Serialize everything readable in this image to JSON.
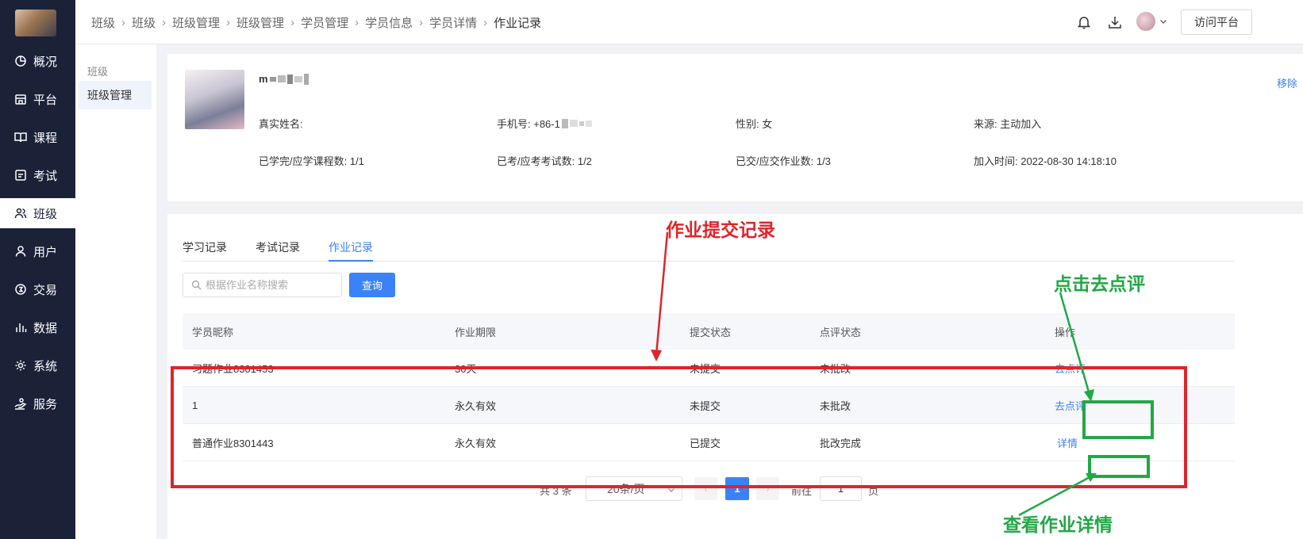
{
  "sidebar": {
    "logo_alt": "",
    "items": [
      {
        "label": "概况",
        "icon": "pie-chart-icon"
      },
      {
        "label": "平台",
        "icon": "storefront-icon"
      },
      {
        "label": "课程",
        "icon": "open-book-icon"
      },
      {
        "label": "考试",
        "icon": "exam-icon"
      },
      {
        "label": "班级",
        "icon": "users-icon",
        "active": true
      },
      {
        "label": "用户",
        "icon": "user-icon"
      },
      {
        "label": "交易",
        "icon": "transaction-icon"
      },
      {
        "label": "数据",
        "icon": "bar-chart-icon"
      },
      {
        "label": "系统",
        "icon": "gear-icon"
      },
      {
        "label": "服务",
        "icon": "service-icon"
      }
    ]
  },
  "header": {
    "breadcrumb": [
      "班级",
      "班级",
      "班级管理",
      "班级管理",
      "学员管理",
      "学员信息",
      "学员详情",
      "作业记录"
    ],
    "visit_label": "访问平台"
  },
  "subnav": {
    "group_label": "班级",
    "item_label": "班级管理"
  },
  "student": {
    "name_visible": "m",
    "remove_label": "移除",
    "fields": {
      "real_name": "真实姓名:",
      "phone": "手机号: +86-1",
      "gender": "性别: 女",
      "source": "来源: 主动加入",
      "courses": "已学完/应学课程数: 1/1",
      "exams": "已考/应考考试数: 1/2",
      "homework": "已交/应交作业数: 1/3",
      "join_time": "加入时间: 2022-08-30 14:18:10"
    }
  },
  "records": {
    "tabs": [
      "学习记录",
      "考试记录",
      "作业记录"
    ],
    "active_tab": 2,
    "search_placeholder": "根据作业名称搜索",
    "query_label": "查询",
    "columns": [
      "学员昵称",
      "作业期限",
      "提交状态",
      "点评状态",
      "操作"
    ],
    "rows": [
      {
        "name": "习题作业8301453",
        "deadline": "30天",
        "submit": "未提交",
        "review": "未批改",
        "action": "去点评"
      },
      {
        "name": "1",
        "deadline": "永久有效",
        "submit": "未提交",
        "review": "未批改",
        "action": "去点评"
      },
      {
        "name": "普通作业8301443",
        "deadline": "永久有效",
        "submit": "已提交",
        "review": "批改完成",
        "action": "详情"
      }
    ]
  },
  "pagination": {
    "total": "共 3 条",
    "page_size": "20条/页",
    "prev": "‹",
    "current": "1",
    "next": "›",
    "goto_label": "前往",
    "goto_value": "1",
    "page_label": "页"
  },
  "annotations": {
    "submission_record": "作业提交记录",
    "click_review": "点击去点评",
    "view_detail": "查看作业详情",
    "box_color_red": "#e0242a",
    "box_color_green": "#22a845"
  }
}
